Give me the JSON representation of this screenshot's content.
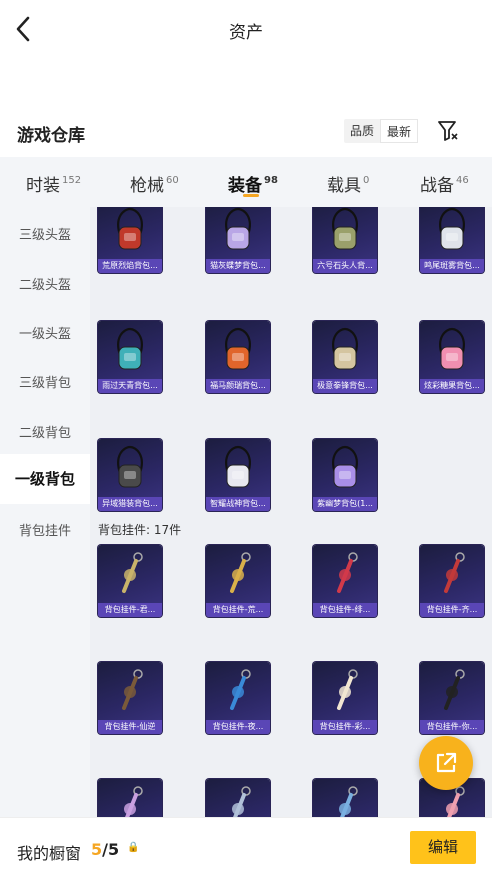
{
  "header": {
    "title": "资产"
  },
  "warehouse": {
    "title": "游戏仓库",
    "sort": [
      "品质",
      "最新"
    ]
  },
  "tabs": [
    {
      "label": "时装",
      "count": "152"
    },
    {
      "label": "枪械",
      "count": "60"
    },
    {
      "label": "装备",
      "count": "98"
    },
    {
      "label": "载具",
      "count": "0"
    },
    {
      "label": "战备",
      "count": "46"
    }
  ],
  "sidebar": [
    "三级头盔",
    "二级头盔",
    "一级头盔",
    "三级背包",
    "二级背包",
    "一级背包",
    "背包挂件"
  ],
  "items": [
    "荒原烈焰背包...",
    "猫灰蝶梦背包...",
    "六号石头人背...",
    "鸣尾斑雾背包...",
    "雨过天青背包...",
    "福马颜瑞背包...",
    "极意拳锋背包...",
    "炫彩糖果背包...",
    "异域猎装背包...",
    "智耀战神背包...",
    "紫幽梦背包(1..."
  ],
  "pendant_section": "背包挂件: 17件",
  "pendants": [
    "背包挂件-君...",
    "背包挂件-荒...",
    "背包挂件-绯...",
    "背包挂件-齐...",
    "背包挂件-仙逆",
    "背包挂件-夜...",
    "背包挂件-彩...",
    "背包挂件-你...",
    "",
    "",
    "",
    ""
  ],
  "bottom": {
    "label": "我的橱窗",
    "count_current": "5",
    "count_total": "/5",
    "lock": "🔒",
    "edit": "编辑"
  },
  "colors": {
    "accent": "#f5a623",
    "button": "#ffc21a",
    "card_caption": "#5a46b6"
  }
}
